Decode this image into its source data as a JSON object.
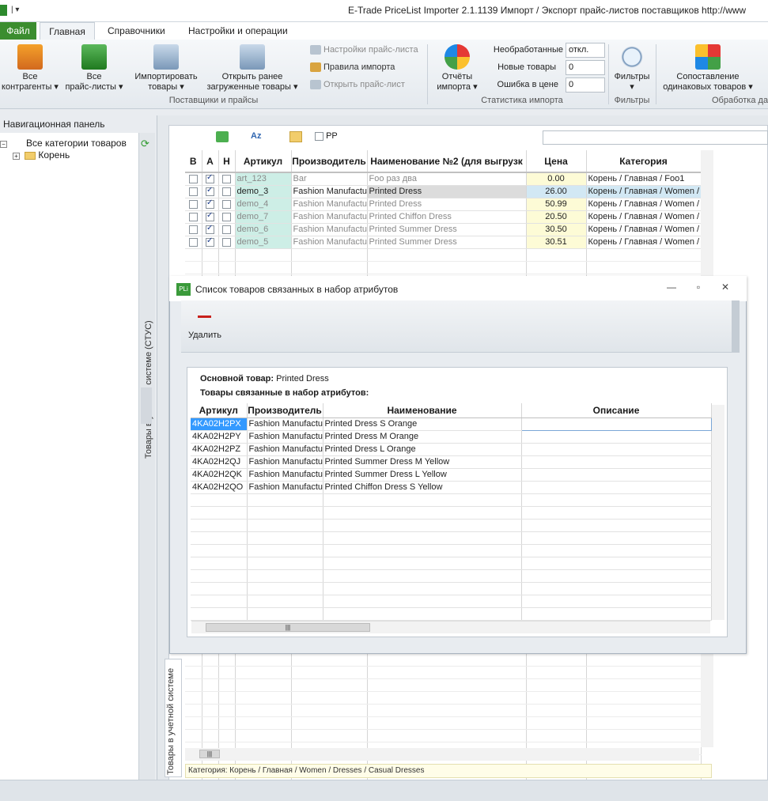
{
  "window": {
    "title": "E-Trade PriceList Importer 2.1.1139    Импорт / Экспорт прайс-листов поставщиков     http://www"
  },
  "ribbon_tabs": {
    "file": "Файл",
    "home": "Главная",
    "refs": "Справочники",
    "settings": "Настройки и операции"
  },
  "ribbon": {
    "all_contractors": "Все\nконтрагенты ▾",
    "all_pricelists": "Все\nпрайс-листы ▾",
    "import_goods": "Импортировать\nтовары ▾",
    "open_loaded": "Открыть ранее\nзагруженные товары ▾",
    "pricelist_settings": "Настройки прайс-листа",
    "import_rules": "Правила импорта",
    "open_pricelist": "Открыть прайс-лист",
    "group_suppliers": "Поставщики и прайсы",
    "import_reports": "Отчёты\nимпорта ▾",
    "stat_unprocessed": "Необработанные",
    "stat_unprocessed_val": "откл.",
    "stat_new": "Новые товары",
    "stat_new_val": "0",
    "stat_price_err": "Ошибка в цене",
    "stat_price_err_val": "0",
    "group_stats": "Статистика импорта",
    "filters": "Фильтры\n▾",
    "group_filters": "Фильтры",
    "compare_same": "Сопоставление\nодинаковых товаров ▾",
    "group_processing": "Обработка да"
  },
  "nav": {
    "header": "Навигационная панель",
    "all_categories": "Все категории товаров",
    "root": "Корень",
    "side_label": "Товары в учетной системе (СТУС)"
  },
  "grid_toolbar": {
    "pp_label": "PP"
  },
  "main_grid": {
    "headers": [
      "В",
      "А",
      "Н",
      "Артикул",
      "Производитель",
      "Наименование №2 (для выгрузк",
      "Цена",
      "Категория"
    ],
    "rows": [
      {
        "b": false,
        "a": true,
        "n": false,
        "article": "art_123",
        "maker": "Bar",
        "name": "Foo раз два",
        "price": "0.00",
        "category": "Корень / Главная / Foo1"
      },
      {
        "b": false,
        "a": true,
        "n": false,
        "article": "demo_3",
        "maker": "Fashion Manufactur",
        "name": "Printed Dress",
        "price": "26.00",
        "category": "Корень / Главная / Women /"
      },
      {
        "b": false,
        "a": true,
        "n": false,
        "article": "demo_4",
        "maker": "Fashion Manufactur",
        "name": "Printed Dress",
        "price": "50.99",
        "category": "Корень / Главная / Women /"
      },
      {
        "b": false,
        "a": true,
        "n": false,
        "article": "demo_7",
        "maker": "Fashion Manufactur",
        "name": "Printed Chiffon Dress",
        "price": "20.50",
        "category": "Корень / Главная / Women /"
      },
      {
        "b": false,
        "a": true,
        "n": false,
        "article": "demo_6",
        "maker": "Fashion Manufactur",
        "name": "Printed Summer Dress",
        "price": "30.50",
        "category": "Корень / Главная / Women /"
      },
      {
        "b": false,
        "a": true,
        "n": false,
        "article": "demo_5",
        "maker": "Fashion Manufactur",
        "name": "Printed Summer Dress",
        "price": "30.51",
        "category": "Корень / Главная / Women /"
      }
    ],
    "selected_row": 1
  },
  "dialog": {
    "title": "Список товаров связанных в набор атрибутов",
    "delete_label": "Удалить",
    "main_product_label": "Основной товар:",
    "main_product_value": "Printed Dress",
    "linked_title": "Товары связанные в набор атрибутов:",
    "headers": [
      "Артикул",
      "Производитель",
      "Наименование",
      "Описание"
    ],
    "rows": [
      {
        "article": "4KA02H2PX",
        "maker": "Fashion Manufactur",
        "name": "Printed Dress S Orange",
        "desc": ""
      },
      {
        "article": "4KA02H2PY",
        "maker": "Fashion Manufactur",
        "name": "Printed Dress M Orange",
        "desc": ""
      },
      {
        "article": "4KA02H2PZ",
        "maker": "Fashion Manufactur",
        "name": "Printed Dress L Orange",
        "desc": ""
      },
      {
        "article": "4KA02H2QJ",
        "maker": "Fashion Manufactur",
        "name": "Printed Summer Dress M Yellow",
        "desc": ""
      },
      {
        "article": "4KA02H2QK",
        "maker": "Fashion Manufactur",
        "name": "Printed Summer Dress L Yellow",
        "desc": ""
      },
      {
        "article": "4KA02H2QO",
        "maker": "Fashion Manufactur",
        "name": "Printed Chiffon Dress S Yellow",
        "desc": ""
      }
    ]
  },
  "bottom": {
    "vtab_label": "Товары в учетной системе",
    "category_path": "Категория: Корень / Главная / Women / Dresses / Casual Dresses"
  },
  "colors": {
    "accent_green": "#3b8d2f",
    "selection_blue": "#3399ff",
    "delete_red": "#c8201c"
  }
}
